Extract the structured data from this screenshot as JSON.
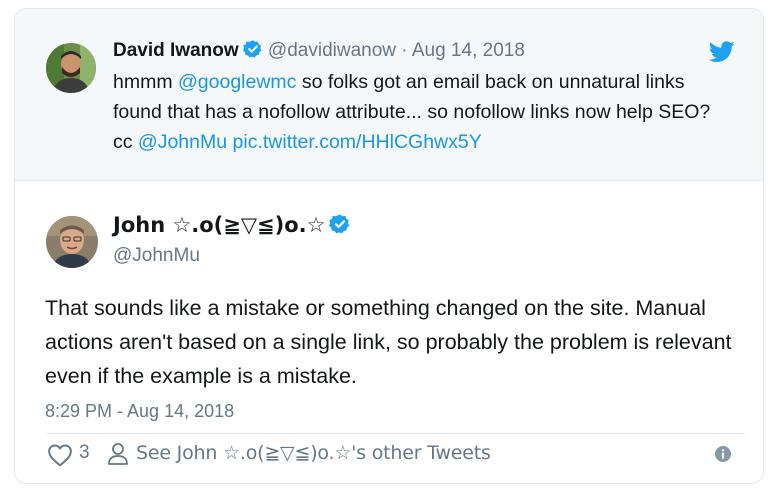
{
  "quoted_tweet": {
    "author_name": "David Iwanow",
    "author_handle": "@davidiwanow",
    "separator": "·",
    "date": "Aug 14, 2018",
    "text_1": "hmmm ",
    "mention_1": "@googlewmc",
    "text_2": " so folks got an email back on unnatural links found that has a nofollow attribute... so nofollow links now help SEO? cc ",
    "mention_2": "@JohnMu",
    "text_3": " ",
    "pic_link": "pic.twitter.com/HHlCGhwx5Y"
  },
  "main_tweet": {
    "author_name": "John ☆.o(≧▽≦)o.☆",
    "author_handle": "@JohnMu",
    "text": "That sounds like a mistake or something changed on the site. Manual actions aren't based on a single link, so probably the problem is relevant even if the example is a mistake.",
    "timestamp": "8:29 PM - Aug 14, 2018"
  },
  "actions": {
    "like_count": "3",
    "other_tweets_label": "See John ☆.o(≧▽≦)o.☆'s other Tweets"
  },
  "icons": {
    "verified": "verified-badge-icon",
    "twitter": "twitter-bird-icon",
    "like": "heart-icon",
    "profile": "person-icon",
    "info": "info-icon"
  },
  "colors": {
    "link": "#1b95e0",
    "muted": "#657786",
    "text": "#14171a",
    "quoted_bg": "#f5f8fa",
    "verified": "#1da1f2"
  }
}
